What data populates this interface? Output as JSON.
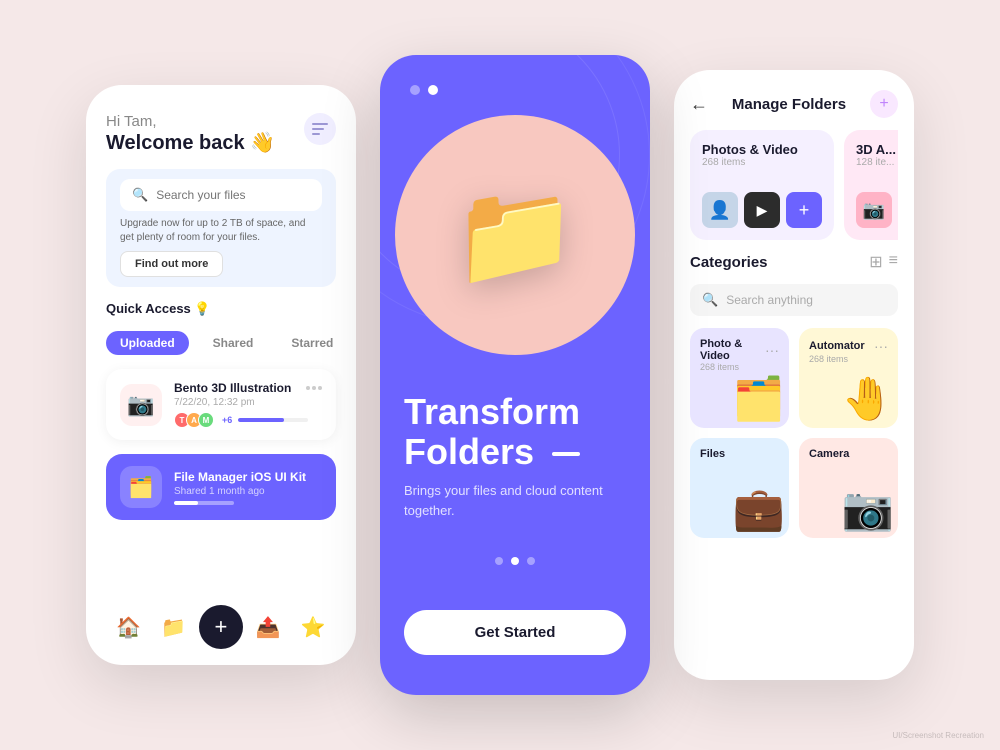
{
  "background": "#f5e8e8",
  "phone1": {
    "greeting": "Hi Tam,",
    "welcome": "Welcome back 👋",
    "menu_icon": "☰",
    "search_placeholder": "Search your files",
    "upgrade_text": "Upgrade now for up to 2 TB of space, and get plenty of room for your files.",
    "find_out_label": "Find out more",
    "quick_access_label": "Quick Access 💡",
    "tabs": [
      "Uploaded",
      "Shared",
      "Starred"
    ],
    "active_tab": 0,
    "files": [
      {
        "name": "Bento 3D Illustration",
        "date": "7/22/20, 12:32 pm",
        "icon": "📷",
        "progress": 65,
        "avatars": 3,
        "count_badge": "+6"
      },
      {
        "name": "File Manager iOS UI Kit",
        "date": "Shared 1 month ago",
        "icon": "🗂️",
        "progress": 40
      }
    ],
    "nav_items": [
      "home",
      "folder",
      "plus",
      "share",
      "star"
    ]
  },
  "phone2": {
    "title_line1": "Transform",
    "title_line2": "Folders",
    "subtitle": "Brings your files and cloud content together.",
    "cta_label": "Get Started",
    "pagination_dots": 3,
    "active_dot": 1
  },
  "phone3": {
    "header_title": "Manage Folders",
    "back_icon": "←",
    "add_icon": "+",
    "folders": [
      {
        "name": "Photos & Video",
        "count": "268 items"
      },
      {
        "name": "3D A...",
        "count": "128 ite..."
      }
    ],
    "categories_label": "Categories",
    "search_placeholder": "Search anything",
    "categories": [
      {
        "name": "Photo & Video",
        "count": "268 items",
        "emoji": "🗂️",
        "color": "purple"
      },
      {
        "name": "Automator",
        "count": "268 items",
        "emoji": "🤚",
        "color": "yellow"
      },
      {
        "name": "Files",
        "count": "",
        "emoji": "💼",
        "color": "blue"
      },
      {
        "name": "Camera",
        "count": "",
        "emoji": "📷",
        "color": "salmon"
      }
    ]
  }
}
